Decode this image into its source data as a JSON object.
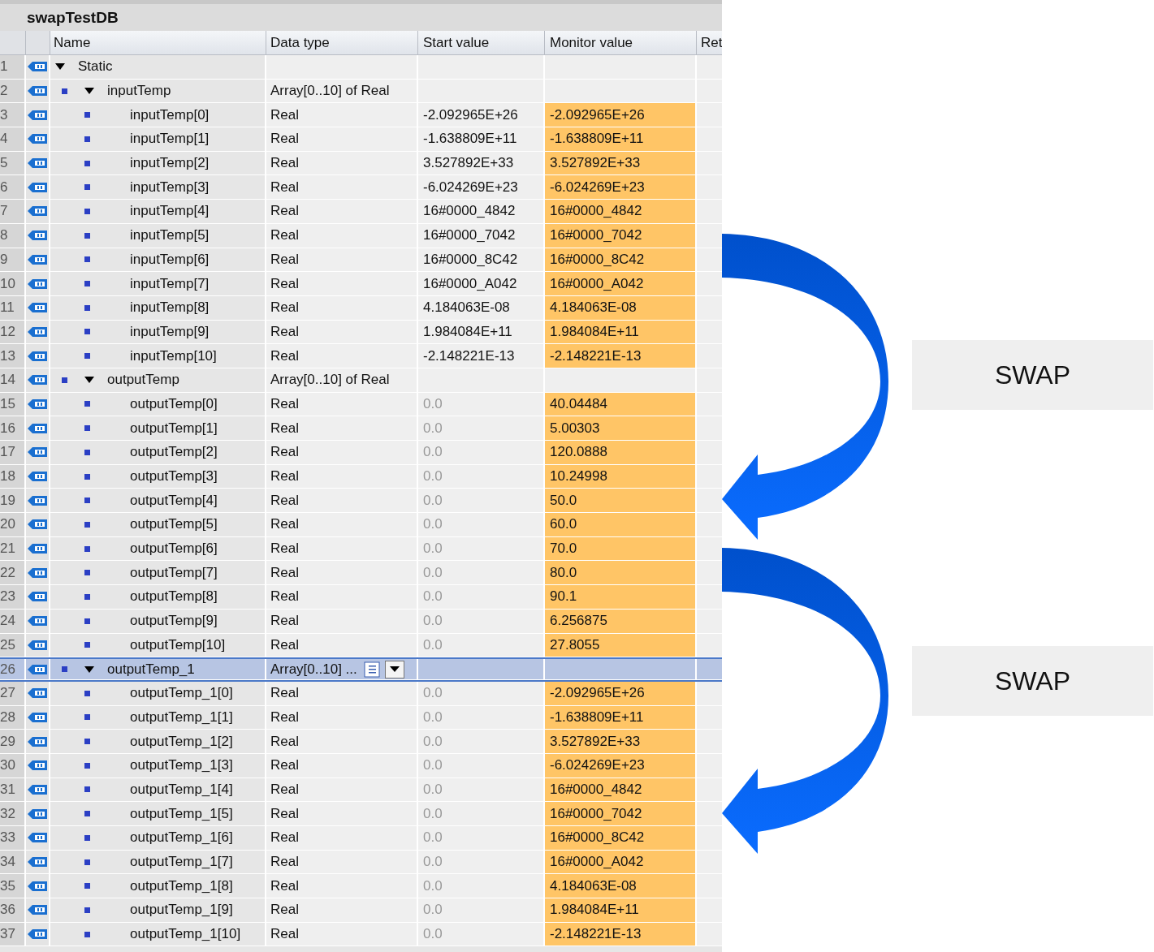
{
  "title": "swapTestDB",
  "columns": [
    "Name",
    "Data type",
    "Start value",
    "Monitor value",
    "Ret"
  ],
  "rows": [
    {
      "number": "1",
      "name": "Static",
      "expanded": true,
      "selected": false,
      "editing": false,
      "children": [
        {
          "number": "2",
          "name": "inputTemp",
          "data_type": "Array[0..10] of Real",
          "expanded": true,
          "selected": false,
          "editing": false,
          "start_greyed": false,
          "children": [
            {
              "number": "3",
              "name": "inputTemp[0]",
              "data_type": "Real",
              "start_value": "-2.092965E+26",
              "monitor_value": "-2.092965E+26",
              "selected": false,
              "editing": false
            },
            {
              "number": "4",
              "name": "inputTemp[1]",
              "data_type": "Real",
              "start_value": "-1.638809E+11",
              "monitor_value": "-1.638809E+11",
              "selected": false,
              "editing": false
            },
            {
              "number": "5",
              "name": "inputTemp[2]",
              "data_type": "Real",
              "start_value": "3.527892E+33",
              "monitor_value": "3.527892E+33",
              "selected": false,
              "editing": false
            },
            {
              "number": "6",
              "name": "inputTemp[3]",
              "data_type": "Real",
              "start_value": "-6.024269E+23",
              "monitor_value": "-6.024269E+23",
              "selected": false,
              "editing": false
            },
            {
              "number": "7",
              "name": "inputTemp[4]",
              "data_type": "Real",
              "start_value": "16#0000_4842",
              "monitor_value": "16#0000_4842",
              "selected": false,
              "editing": false
            },
            {
              "number": "8",
              "name": "inputTemp[5]",
              "data_type": "Real",
              "start_value": "16#0000_7042",
              "monitor_value": "16#0000_7042",
              "selected": false,
              "editing": false
            },
            {
              "number": "9",
              "name": "inputTemp[6]",
              "data_type": "Real",
              "start_value": "16#0000_8C42",
              "monitor_value": "16#0000_8C42",
              "selected": false,
              "editing": false
            },
            {
              "number": "10",
              "name": "inputTemp[7]",
              "data_type": "Real",
              "start_value": "16#0000_A042",
              "monitor_value": "16#0000_A042",
              "selected": false,
              "editing": false
            },
            {
              "number": "11",
              "name": "inputTemp[8]",
              "data_type": "Real",
              "start_value": "4.184063E-08",
              "monitor_value": "4.184063E-08",
              "selected": false,
              "editing": false
            },
            {
              "number": "12",
              "name": "inputTemp[9]",
              "data_type": "Real",
              "start_value": "1.984084E+11",
              "monitor_value": "1.984084E+11",
              "selected": false,
              "editing": false
            },
            {
              "number": "13",
              "name": "inputTemp[10]",
              "data_type": "Real",
              "start_value": "-2.148221E-13",
              "monitor_value": "-2.148221E-13",
              "selected": false,
              "editing": false
            }
          ]
        },
        {
          "number": "14",
          "name": "outputTemp",
          "data_type": "Array[0..10] of Real",
          "expanded": true,
          "selected": false,
          "editing": false,
          "start_greyed": true,
          "children": [
            {
              "number": "15",
              "name": "outputTemp[0]",
              "data_type": "Real",
              "start_value": "0.0",
              "monitor_value": "40.04484",
              "selected": false,
              "editing": false
            },
            {
              "number": "16",
              "name": "outputTemp[1]",
              "data_type": "Real",
              "start_value": "0.0",
              "monitor_value": "5.00303",
              "selected": false,
              "editing": false
            },
            {
              "number": "17",
              "name": "outputTemp[2]",
              "data_type": "Real",
              "start_value": "0.0",
              "monitor_value": "120.0888",
              "selected": false,
              "editing": false
            },
            {
              "number": "18",
              "name": "outputTemp[3]",
              "data_type": "Real",
              "start_value": "0.0",
              "monitor_value": "10.24998",
              "selected": false,
              "editing": false
            },
            {
              "number": "19",
              "name": "outputTemp[4]",
              "data_type": "Real",
              "start_value": "0.0",
              "monitor_value": "50.0",
              "selected": false,
              "editing": false
            },
            {
              "number": "20",
              "name": "outputTemp[5]",
              "data_type": "Real",
              "start_value": "0.0",
              "monitor_value": "60.0",
              "selected": false,
              "editing": false
            },
            {
              "number": "21",
              "name": "outputTemp[6]",
              "data_type": "Real",
              "start_value": "0.0",
              "monitor_value": "70.0",
              "selected": false,
              "editing": false
            },
            {
              "number": "22",
              "name": "outputTemp[7]",
              "data_type": "Real",
              "start_value": "0.0",
              "monitor_value": "80.0",
              "selected": false,
              "editing": false
            },
            {
              "number": "23",
              "name": "outputTemp[8]",
              "data_type": "Real",
              "start_value": "0.0",
              "monitor_value": "90.1",
              "selected": false,
              "editing": false
            },
            {
              "number": "24",
              "name": "outputTemp[9]",
              "data_type": "Real",
              "start_value": "0.0",
              "monitor_value": "6.256875",
              "selected": false,
              "editing": false
            },
            {
              "number": "25",
              "name": "outputTemp[10]",
              "data_type": "Real",
              "start_value": "0.0",
              "monitor_value": "27.8055",
              "selected": false,
              "editing": false
            }
          ]
        },
        {
          "number": "26",
          "name": "outputTemp_1",
          "data_type": "Array[0..10] ...",
          "expanded": true,
          "selected": true,
          "editing": true,
          "start_greyed": true,
          "children": [
            {
              "number": "27",
              "name": "outputTemp_1[0]",
              "data_type": "Real",
              "start_value": "0.0",
              "monitor_value": "-2.092965E+26",
              "selected": false,
              "editing": false
            },
            {
              "number": "28",
              "name": "outputTemp_1[1]",
              "data_type": "Real",
              "start_value": "0.0",
              "monitor_value": "-1.638809E+11",
              "selected": false,
              "editing": false
            },
            {
              "number": "29",
              "name": "outputTemp_1[2]",
              "data_type": "Real",
              "start_value": "0.0",
              "monitor_value": "3.527892E+33",
              "selected": false,
              "editing": false
            },
            {
              "number": "30",
              "name": "outputTemp_1[3]",
              "data_type": "Real",
              "start_value": "0.0",
              "monitor_value": "-6.024269E+23",
              "selected": false,
              "editing": false
            },
            {
              "number": "31",
              "name": "outputTemp_1[4]",
              "data_type": "Real",
              "start_value": "0.0",
              "monitor_value": "16#0000_4842",
              "selected": false,
              "editing": false
            },
            {
              "number": "32",
              "name": "outputTemp_1[5]",
              "data_type": "Real",
              "start_value": "0.0",
              "monitor_value": "16#0000_7042",
              "selected": false,
              "editing": false
            },
            {
              "number": "33",
              "name": "outputTemp_1[6]",
              "data_type": "Real",
              "start_value": "0.0",
              "monitor_value": "16#0000_8C42",
              "selected": false,
              "editing": false
            },
            {
              "number": "34",
              "name": "outputTemp_1[7]",
              "data_type": "Real",
              "start_value": "0.0",
              "monitor_value": "16#0000_A042",
              "selected": false,
              "editing": false
            },
            {
              "number": "35",
              "name": "outputTemp_1[8]",
              "data_type": "Real",
              "start_value": "0.0",
              "monitor_value": "4.184063E-08",
              "selected": false,
              "editing": false
            },
            {
              "number": "36",
              "name": "outputTemp_1[9]",
              "data_type": "Real",
              "start_value": "0.0",
              "monitor_value": "1.984084E+11",
              "selected": false,
              "editing": false
            },
            {
              "number": "37",
              "name": "outputTemp_1[10]",
              "data_type": "Real",
              "start_value": "0.0",
              "monitor_value": "-2.148221E-13",
              "selected": false,
              "editing": false
            }
          ]
        }
      ]
    }
  ],
  "annotations": [
    "SWAP",
    "SWAP"
  ]
}
